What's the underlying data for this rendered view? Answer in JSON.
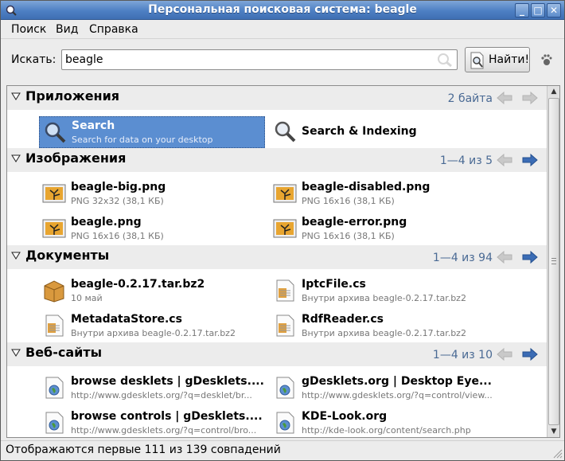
{
  "window": {
    "title": "Персональная поисковая система: beagle",
    "controls": [
      "_",
      "□",
      "✕"
    ]
  },
  "menu": [
    {
      "label": "Поиск"
    },
    {
      "label": "Вид"
    },
    {
      "label": "Справка"
    }
  ],
  "search": {
    "label": "Искать:",
    "value": "beagle",
    "button_label": "Найти!"
  },
  "categories": [
    {
      "title": "Приложения",
      "count": "2 байта",
      "items": [
        {
          "name": "Search",
          "sub": "Search for data on your desktop",
          "icon": "search-icon",
          "selected": true
        },
        {
          "name": "Search & Indexing",
          "sub": "",
          "icon": "search-icon",
          "selected": false
        }
      ]
    },
    {
      "title": "Изображения",
      "count": "1—4 из 5",
      "items": [
        {
          "name": "beagle-big.png",
          "sub": "PNG 32x32 (38,1 КБ)",
          "icon": "image-icon"
        },
        {
          "name": "beagle-disabled.png",
          "sub": "PNG 16x16 (38,1 КБ)",
          "icon": "image-icon"
        },
        {
          "name": "beagle.png",
          "sub": "PNG 16x16 (38,1 КБ)",
          "icon": "image-icon"
        },
        {
          "name": "beagle-error.png",
          "sub": "PNG 16x16 (38,1 КБ)",
          "icon": "image-icon"
        }
      ]
    },
    {
      "title": "Документы",
      "count": "1—4 из 94",
      "items": [
        {
          "name": "beagle-0.2.17.tar.bz2",
          "sub": "10 май",
          "icon": "archive-icon"
        },
        {
          "name": "IptcFile.cs",
          "sub": "Внутри архива beagle-0.2.17.tar.bz2",
          "icon": "source-file-icon"
        },
        {
          "name": "MetadataStore.cs",
          "sub": "Внутри архива beagle-0.2.17.tar.bz2",
          "icon": "source-file-icon"
        },
        {
          "name": "RdfReader.cs",
          "sub": "Внутри архива beagle-0.2.17.tar.bz2",
          "icon": "source-file-icon"
        }
      ]
    },
    {
      "title": "Веб-сайты",
      "count": "1—4 из 10",
      "items": [
        {
          "name": "browse desklets | gDesklets....",
          "sub": "http://www.gdesklets.org/?q=desklet/br...",
          "icon": "web-page-icon"
        },
        {
          "name": "gDesklets.org | Desktop Eye...",
          "sub": "http://www.gdesklets.org/?q=control/view...",
          "icon": "web-page-icon"
        },
        {
          "name": "browse controls | gDesklets....",
          "sub": "http://www.gdesklets.org/?q=control/bro...",
          "icon": "web-page-icon"
        },
        {
          "name": "KDE-Look.org",
          "sub": "http://kde-look.org/content/search.php",
          "icon": "web-page-icon"
        }
      ]
    }
  ],
  "status": {
    "text": "Отображаются первые 111 из 139 совпадений"
  },
  "colors": {
    "titlebar": "#4d7fc3",
    "selection": "#5b8ed1",
    "count_text": "#4a6a94",
    "arrow_active": "#3b6cb5",
    "arrow_disabled": "#c4c4c4"
  }
}
